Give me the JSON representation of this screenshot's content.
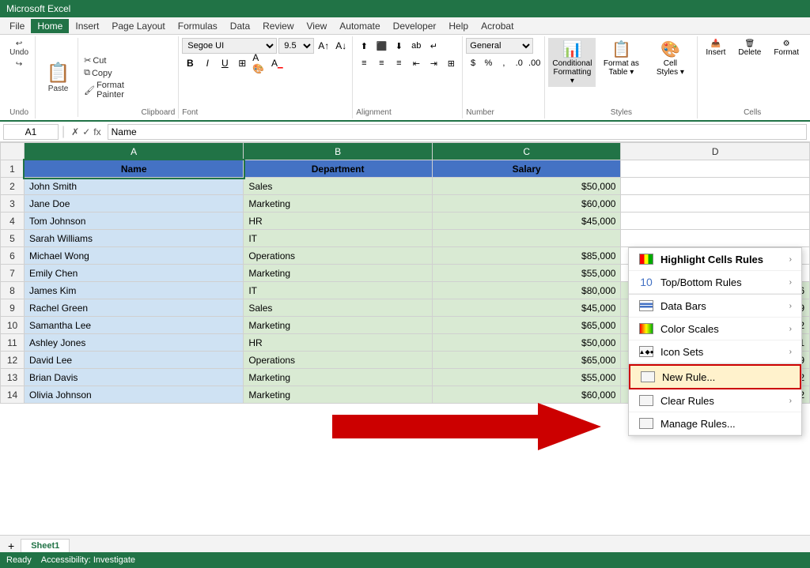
{
  "titlebar": {
    "text": "Microsoft Excel"
  },
  "menubar": {
    "items": [
      "File",
      "Home",
      "Insert",
      "Page Layout",
      "Formulas",
      "Data",
      "Review",
      "View",
      "Automate",
      "Developer",
      "Help",
      "Acrobat"
    ]
  },
  "ribbon": {
    "active_tab": "Home",
    "tabs": [
      "File",
      "Home",
      "Insert",
      "Page Layout",
      "Formulas",
      "Data",
      "Review",
      "View",
      "Automate",
      "Developer",
      "Help",
      "Acrobat"
    ],
    "groups": {
      "undo": {
        "label": "Undo",
        "undo_label": "Undo",
        "redo_label": "Redo"
      },
      "clipboard": {
        "label": "Clipboard",
        "paste_label": "Paste",
        "cut_label": "Cut",
        "copy_label": "Copy",
        "format_painter_label": "Format Painter"
      },
      "font": {
        "label": "Font",
        "font_name": "Segoe UI",
        "font_size": "9.5"
      },
      "alignment": {
        "label": "Alignment"
      },
      "number": {
        "label": "Number",
        "format": "General"
      },
      "styles": {
        "label": "Styles",
        "conditional_formatting_label": "Conditional\nFormatting",
        "format_table_label": "Format as\nTable",
        "cell_styles_label": "Cell\nStyles"
      },
      "cells": {
        "label": "Cells",
        "insert_label": "Insert",
        "delete_label": "Delete",
        "format_label": "Format"
      }
    }
  },
  "formula_bar": {
    "cell_ref": "A1",
    "formula_value": "Name",
    "checkmark": "✓",
    "cross": "✗",
    "fx": "fx"
  },
  "spreadsheet": {
    "columns": [
      "A",
      "B",
      "C",
      "D"
    ],
    "headers": [
      "Name",
      "Department",
      "Salary",
      ""
    ],
    "rows": [
      {
        "num": 2,
        "name": "John Smith",
        "dept": "Sales",
        "salary": "$50,000",
        "date": ""
      },
      {
        "num": 3,
        "name": "Jane Doe",
        "dept": "Marketing",
        "salary": "$60,000",
        "date": ""
      },
      {
        "num": 4,
        "name": "Tom Johnson",
        "dept": "HR",
        "salary": "$45,000",
        "date": ""
      },
      {
        "num": 5,
        "name": "Sarah Williams",
        "dept": "IT",
        "salary": "",
        "date": ""
      },
      {
        "num": 6,
        "name": "Michael Wong",
        "dept": "Operations",
        "salary": "$85,000",
        "date": ""
      },
      {
        "num": 7,
        "name": "Emily Chen",
        "dept": "Marketing",
        "salary": "$55,000",
        "date": ""
      },
      {
        "num": 8,
        "name": "James Kim",
        "dept": "IT",
        "salary": "$80,000",
        "date": "15/09/2016"
      },
      {
        "num": 9,
        "name": "Rachel Green",
        "dept": "Sales",
        "salary": "$45,000",
        "date": "28/02/2019"
      },
      {
        "num": 10,
        "name": "Samantha Lee",
        "dept": "Marketing",
        "salary": "$65,000",
        "date": "15/01/2022"
      },
      {
        "num": 11,
        "name": "Ashley Jones",
        "dept": "HR",
        "salary": "$50,000",
        "date": "01/01/2021"
      },
      {
        "num": 12,
        "name": "David Lee",
        "dept": "Operations",
        "salary": "$65,000",
        "date": "10/08/2019"
      },
      {
        "num": 13,
        "name": "Brian Davis",
        "dept": "Marketing",
        "salary": "$55,000",
        "date": "01/02/2022"
      },
      {
        "num": 14,
        "name": "Olivia Johnson",
        "dept": "Marketing",
        "salary": "$60,000",
        "date": "01/03/2022"
      }
    ]
  },
  "dropdown_menu": {
    "items": [
      {
        "id": "highlight-cells",
        "label": "Highlight Cells Rules",
        "has_arrow": true,
        "icon": "highlight"
      },
      {
        "id": "top-bottom",
        "label": "Top/Bottom Rules",
        "has_arrow": true,
        "icon": "topbottom"
      },
      {
        "id": "data-bars",
        "label": "Data Bars",
        "has_arrow": true,
        "icon": "databars"
      },
      {
        "id": "color-scales",
        "label": "Color Scales",
        "has_arrow": true,
        "icon": "colorscales"
      },
      {
        "id": "icon-sets",
        "label": "Icon Sets",
        "has_arrow": true,
        "icon": "iconsets"
      },
      {
        "id": "new-rule",
        "label": "New Rule...",
        "has_arrow": false,
        "icon": "newrule",
        "highlighted": true
      },
      {
        "id": "clear-rules",
        "label": "Clear Rules",
        "has_arrow": true,
        "icon": "clearrule"
      },
      {
        "id": "manage-rules",
        "label": "Manage Rules...",
        "has_arrow": false,
        "icon": "managerule"
      }
    ]
  },
  "sheet_tabs": {
    "active": "Sheet1",
    "tabs": [
      "Sheet1"
    ]
  },
  "status_bar": {
    "items": [
      "Ready",
      "Accessibility: Investigate"
    ]
  }
}
